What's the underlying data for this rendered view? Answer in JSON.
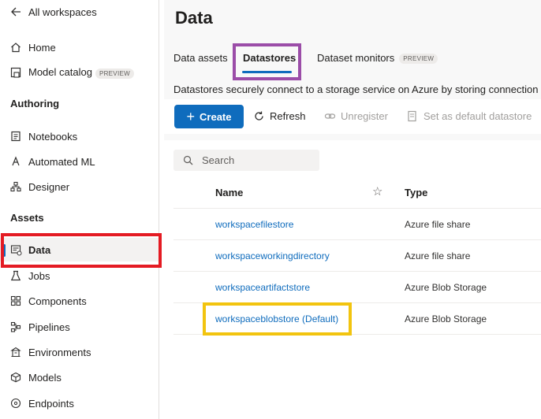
{
  "sidebar": {
    "back_label": "All workspaces",
    "items_top": [
      {
        "label": "Home",
        "icon": "home-icon"
      },
      {
        "label": "Model catalog",
        "badge": "PREVIEW",
        "icon": "catalog-icon"
      }
    ],
    "authoring_header": "Authoring",
    "authoring_items": [
      {
        "label": "Notebooks"
      },
      {
        "label": "Automated ML"
      },
      {
        "label": "Designer"
      }
    ],
    "assets_header": "Assets",
    "assets_items": [
      {
        "label": "Data",
        "selected": true
      },
      {
        "label": "Jobs"
      },
      {
        "label": "Components"
      },
      {
        "label": "Pipelines"
      },
      {
        "label": "Environments"
      },
      {
        "label": "Models"
      },
      {
        "label": "Endpoints"
      }
    ]
  },
  "header": {
    "title": "Data",
    "tabs": [
      {
        "label": "Data assets"
      },
      {
        "label": "Datastores",
        "active": true
      },
      {
        "label": "Dataset monitors",
        "badge": "PREVIEW"
      }
    ],
    "description": "Datastores securely connect to a storage service on Azure by storing connection info"
  },
  "toolbar": {
    "create_label": "Create",
    "refresh_label": "Refresh",
    "unregister_label": "Unregister",
    "set_default_label": "Set as default datastore"
  },
  "search": {
    "placeholder": "Search"
  },
  "table": {
    "columns": [
      "Name",
      "Type"
    ],
    "rows": [
      {
        "name": "workspacefilestore",
        "type": "Azure file share"
      },
      {
        "name": "workspaceworkingdirectory",
        "type": "Azure file share"
      },
      {
        "name": "workspaceartifactstore",
        "type": "Azure Blob Storage"
      },
      {
        "name": "workspaceblobstore (Default)",
        "type": "Azure Blob Storage"
      }
    ]
  },
  "colors": {
    "accent": "#0f6cbd",
    "highlight_red": "#e41b23",
    "highlight_purple": "#9b4da8",
    "highlight_yellow": "#f2c40f"
  }
}
